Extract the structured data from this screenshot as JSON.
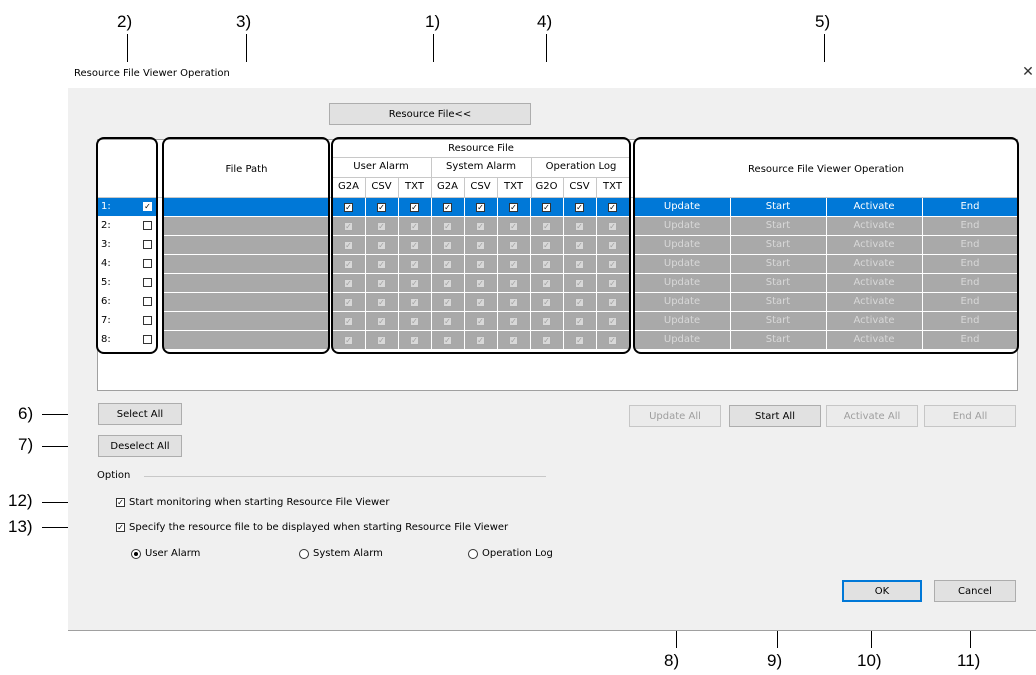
{
  "callouts": {
    "c1": "1)",
    "c2": "2)",
    "c3": "3)",
    "c4": "4)",
    "c5": "5)",
    "c6": "6)",
    "c7": "7)",
    "c8": "8)",
    "c9": "9)",
    "c10": "10)",
    "c11": "11)",
    "c12": "12)",
    "c13": "13)"
  },
  "window": {
    "title": "Resource File Viewer Operation",
    "close_icon": "close-icon"
  },
  "resource_file_button": "Resource File<<",
  "table": {
    "file_path_header": "File Path",
    "resource_file_header": "Resource File",
    "groups": [
      "User Alarm",
      "System Alarm",
      "Operation Log"
    ],
    "subcols": [
      "G2A",
      "CSV",
      "TXT",
      "G2A",
      "CSV",
      "TXT",
      "G2O",
      "CSV",
      "TXT"
    ],
    "viewer_header": "Resource File Viewer Operation",
    "rows": [
      {
        "no": "1:",
        "checked": true,
        "selected": true
      },
      {
        "no": "2:",
        "checked": false,
        "selected": false
      },
      {
        "no": "3:",
        "checked": false,
        "selected": false
      },
      {
        "no": "4:",
        "checked": false,
        "selected": false
      },
      {
        "no": "5:",
        "checked": false,
        "selected": false
      },
      {
        "no": "6:",
        "checked": false,
        "selected": false
      },
      {
        "no": "7:",
        "checked": false,
        "selected": false
      },
      {
        "no": "8:",
        "checked": false,
        "selected": false
      }
    ],
    "actions": [
      "Update",
      "Start",
      "Activate",
      "End"
    ]
  },
  "buttons": {
    "select_all": "Select All",
    "deselect_all": "Deselect All",
    "update_all": "Update All",
    "start_all": "Start All",
    "activate_all": "Activate All",
    "end_all": "End All",
    "ok": "OK",
    "cancel": "Cancel"
  },
  "option": {
    "label": "Option",
    "start_monitoring": "Start monitoring when starting Resource File Viewer",
    "specify_resource": "Specify the resource file to be displayed when starting Resource File Viewer",
    "radios": [
      "User Alarm",
      "System Alarm",
      "Operation Log"
    ],
    "selected_radio": "User Alarm"
  },
  "colors": {
    "selection": "#0078d7",
    "disabled_row": "#a9a9a9",
    "dialog_bg": "#f0f0f0"
  }
}
